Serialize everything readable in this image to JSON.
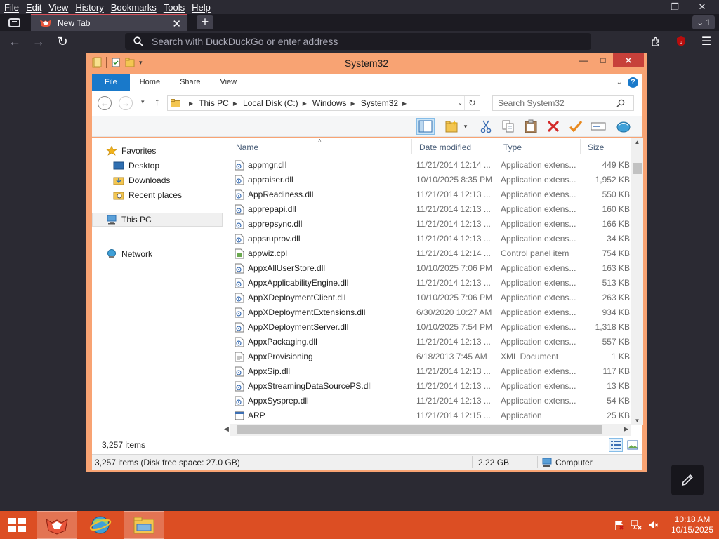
{
  "browser": {
    "menu": [
      "File",
      "Edit",
      "View",
      "History",
      "Bookmarks",
      "Tools",
      "Help"
    ],
    "tab_title": "New Tab",
    "tab_count": "1",
    "url_placeholder": "Search with DuckDuckGo or enter address",
    "colors": {
      "chrome": "#2b2a33",
      "tab_accent": "#d9515a"
    }
  },
  "explorer": {
    "title": "System32",
    "ribbon_tabs": [
      "File",
      "Home",
      "Share",
      "View"
    ],
    "breadcrumb": [
      "This PC",
      "Local Disk (C:)",
      "Windows",
      "System32"
    ],
    "search_placeholder": "Search System32",
    "nav": {
      "favorites": "Favorites",
      "desktop": "Desktop",
      "downloads": "Downloads",
      "recent": "Recent places",
      "this_pc": "This PC",
      "network": "Network"
    },
    "columns": {
      "name": "Name",
      "date": "Date modified",
      "type": "Type",
      "size": "Size"
    },
    "files": [
      {
        "name": "appmgr.dll",
        "date": "11/21/2014 12:14 ...",
        "type": "Application extens...",
        "size": "449 KB",
        "icon": "dll-icon"
      },
      {
        "name": "appraiser.dll",
        "date": "10/10/2025 8:35 PM",
        "type": "Application extens...",
        "size": "1,952 KB",
        "icon": "dll-icon"
      },
      {
        "name": "AppReadiness.dll",
        "date": "11/21/2014 12:13 ...",
        "type": "Application extens...",
        "size": "550 KB",
        "icon": "dll-icon"
      },
      {
        "name": "apprepapi.dll",
        "date": "11/21/2014 12:13 ...",
        "type": "Application extens...",
        "size": "160 KB",
        "icon": "dll-icon"
      },
      {
        "name": "apprepsync.dll",
        "date": "11/21/2014 12:13 ...",
        "type": "Application extens...",
        "size": "166 KB",
        "icon": "dll-icon"
      },
      {
        "name": "appsruprov.dll",
        "date": "11/21/2014 12:13 ...",
        "type": "Application extens...",
        "size": "34 KB",
        "icon": "dll-icon"
      },
      {
        "name": "appwiz.cpl",
        "date": "11/21/2014 12:14 ...",
        "type": "Control panel item",
        "size": "754 KB",
        "icon": "cpl-icon"
      },
      {
        "name": "AppxAllUserStore.dll",
        "date": "10/10/2025 7:06 PM",
        "type": "Application extens...",
        "size": "163 KB",
        "icon": "dll-icon"
      },
      {
        "name": "AppxApplicabilityEngine.dll",
        "date": "11/21/2014 12:13 ...",
        "type": "Application extens...",
        "size": "513 KB",
        "icon": "dll-icon"
      },
      {
        "name": "AppXDeploymentClient.dll",
        "date": "10/10/2025 7:06 PM",
        "type": "Application extens...",
        "size": "263 KB",
        "icon": "dll-icon"
      },
      {
        "name": "AppXDeploymentExtensions.dll",
        "date": "6/30/2020 10:27 AM",
        "type": "Application extens...",
        "size": "934 KB",
        "icon": "dll-icon"
      },
      {
        "name": "AppXDeploymentServer.dll",
        "date": "10/10/2025 7:54 PM",
        "type": "Application extens...",
        "size": "1,318 KB",
        "icon": "dll-icon"
      },
      {
        "name": "AppxPackaging.dll",
        "date": "11/21/2014 12:13 ...",
        "type": "Application extens...",
        "size": "557 KB",
        "icon": "dll-icon"
      },
      {
        "name": "AppxProvisioning",
        "date": "6/18/2013 7:45 AM",
        "type": "XML Document",
        "size": "1 KB",
        "icon": "xml-icon"
      },
      {
        "name": "AppxSip.dll",
        "date": "11/21/2014 12:13 ...",
        "type": "Application extens...",
        "size": "117 KB",
        "icon": "dll-icon"
      },
      {
        "name": "AppxStreamingDataSourcePS.dll",
        "date": "11/21/2014 12:13 ...",
        "type": "Application extens...",
        "size": "13 KB",
        "icon": "dll-icon"
      },
      {
        "name": "AppxSysprep.dll",
        "date": "11/21/2014 12:13 ...",
        "type": "Application extens...",
        "size": "54 KB",
        "icon": "dll-icon"
      },
      {
        "name": "ARP",
        "date": "11/21/2014 12:15 ...",
        "type": "Application",
        "size": "25 KB",
        "icon": "exe-icon"
      }
    ],
    "item_count": "3,257 items",
    "details": {
      "disk": "3,257 items (Disk free space: 27.0 GB)",
      "size": "2.22 GB",
      "location": "Computer"
    },
    "colors": {
      "frame": "#f8a373",
      "file_tab": "#1979ca",
      "close": "#c7403a"
    }
  },
  "taskbar": {
    "time": "10:18 AM",
    "date": "10/15/2025",
    "color": "#dc4e23"
  }
}
